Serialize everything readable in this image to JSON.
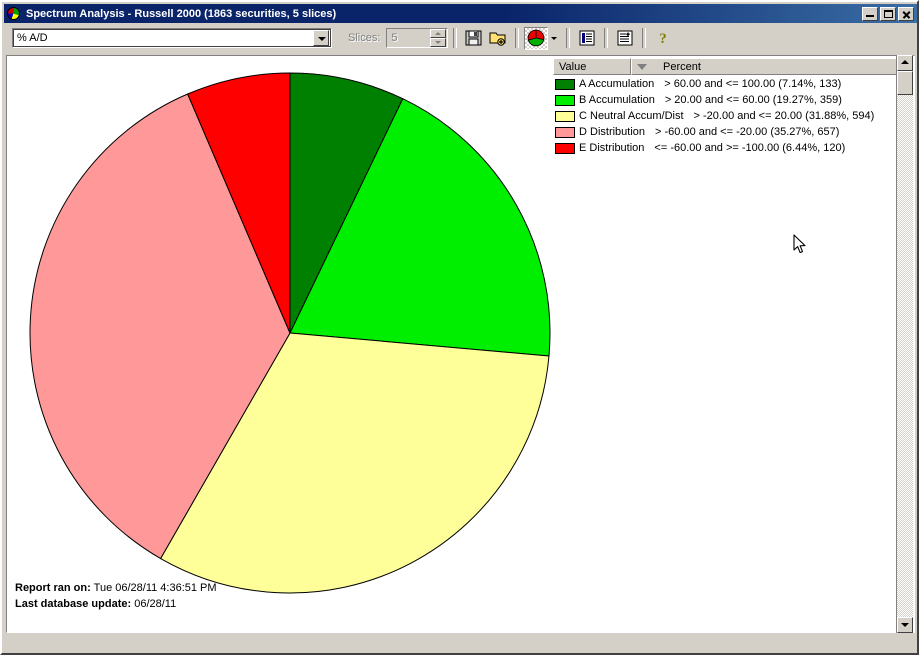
{
  "window": {
    "title": "Spectrum Analysis - Russell 2000 (1863 securities, 5 slices)",
    "icon": "pie-chart-icon",
    "minimize_label": "Minimize",
    "maximize_label": "Maximize",
    "close_label": "Close"
  },
  "toolbar": {
    "metric_select": {
      "value": "% A/D",
      "options": [
        "% A/D"
      ]
    },
    "slices_label": "Slices:",
    "slices_value": "5",
    "buttons": [
      {
        "name": "save-button",
        "icon": "floppy-disk-icon",
        "label": "Save"
      },
      {
        "name": "open-button",
        "icon": "open-folder-icon",
        "label": "Open"
      },
      {
        "name": "pie-chart-view-button",
        "icon": "pie-chart-icon",
        "label": "Pie Chart View"
      },
      {
        "name": "pie-chart-options-dropdown",
        "icon": "chevron-down-icon",
        "label": "Chart Options"
      },
      {
        "name": "report-view-button",
        "icon": "list-report-icon",
        "label": "Report View"
      },
      {
        "name": "add-report-button",
        "icon": "report-add-icon",
        "label": "Add Report"
      },
      {
        "name": "help-button",
        "icon": "question-mark-icon",
        "label": "Help"
      }
    ]
  },
  "legend": {
    "columns": [
      "Value",
      "Percent"
    ],
    "sort_indicator": "descending"
  },
  "footer": {
    "report_ran_label": "Report ran on:",
    "report_ran_value": "Tue 06/28/11 4:36:51 PM",
    "last_update_label": "Last database update:",
    "last_update_value": "06/28/11"
  },
  "chart_data": {
    "type": "pie",
    "title": "Spectrum Analysis - Russell 2000",
    "total_securities": 1863,
    "slice_count": 5,
    "categories": [
      "A Accumulation",
      "B Accumulation",
      "C Neutral Accum/Dist",
      "D Distribution",
      "E Distribution"
    ],
    "values": [
      7.14,
      19.27,
      31.88,
      35.27,
      6.44
    ],
    "counts": [
      133,
      359,
      594,
      657,
      120
    ],
    "colors": [
      "#008000",
      "#00ee00",
      "#ffff99",
      "#ff9999",
      "#ff0000"
    ],
    "ranges": [
      "> 60.00 and <= 100.00",
      "> 20.00 and <= 60.00",
      "> -20.00 and <= 20.00",
      "> -60.00 and <= -20.00",
      "<= -60.00 and >= -100.00"
    ],
    "labels": [
      "> 60.00 and <= 100.00 (7.14%, 133)",
      "> 20.00 and <= 60.00 (19.27%, 359)",
      "> -20.00 and <= 20.00 (31.88%, 594)",
      "> -60.00 and <= -20.00 (35.27%, 657)",
      "<= -60.00 and >= -100.00 (6.44%, 120)"
    ],
    "start_angle": -90,
    "direction": "clockwise",
    "ylabel": "",
    "xlabel": ""
  }
}
